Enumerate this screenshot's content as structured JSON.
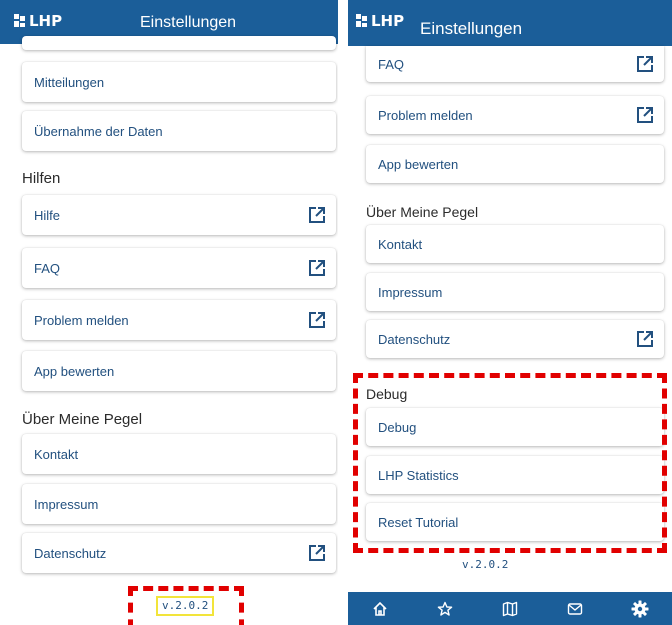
{
  "left": {
    "logo_text": "LHP",
    "title": "Einstellungen",
    "items_top": [
      {
        "label": "Mitteilungen"
      },
      {
        "label": "Übernahme der Daten"
      }
    ],
    "section_hilfen": "Hilfen",
    "hilfen_items": [
      {
        "label": "Hilfe"
      },
      {
        "label": "FAQ"
      },
      {
        "label": "Problem melden"
      },
      {
        "label": "App bewerten"
      }
    ],
    "section_about": "Über Meine Pegel",
    "about_items": [
      {
        "label": "Kontakt"
      },
      {
        "label": "Impressum"
      },
      {
        "label": "Datenschutz"
      }
    ],
    "version": "v.2.0.2"
  },
  "right": {
    "logo_text": "LHP",
    "title": "Einstellungen",
    "items_top": [
      {
        "label": "FAQ"
      },
      {
        "label": "Problem melden"
      },
      {
        "label": "App bewerten"
      }
    ],
    "section_about": "Über Meine Pegel",
    "about_items": [
      {
        "label": "Kontakt"
      },
      {
        "label": "Impressum"
      },
      {
        "label": "Datenschutz"
      }
    ],
    "section_debug": "Debug",
    "debug_items": [
      {
        "label": "Debug"
      },
      {
        "label": "LHP Statistics"
      },
      {
        "label": "Reset Tutorial"
      }
    ],
    "version": "v.2.0.2",
    "nav": [
      "home-icon",
      "star-icon",
      "map-icon",
      "mail-icon",
      "gear-icon"
    ]
  },
  "colors": {
    "appbar": "#1b5e99",
    "link_text": "#22507f",
    "highlight_dashed": "#e10000",
    "version_box": "#f2e43a"
  }
}
